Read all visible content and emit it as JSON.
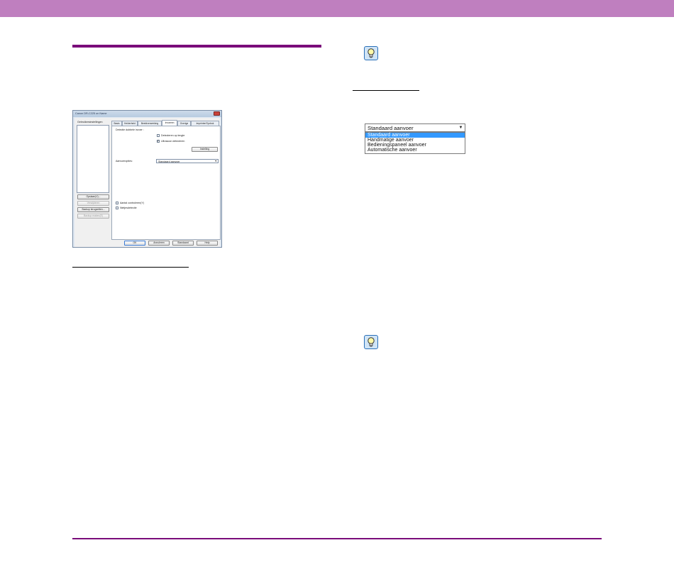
{
  "colors": {
    "header_band": "#bf7fbf",
    "accent_rule": "#7a0c7a",
    "hint_icon": "#2a6fb8",
    "selection": "#3399ff"
  },
  "icons": {
    "hint": "lightbulb-icon"
  },
  "dialog": {
    "title": "Canon DR-C225 on Name",
    "sidebar_label": "Gebruikersinstellingen",
    "side_buttons": [
      {
        "label": "Opslaan(V)...",
        "enabled": true
      },
      {
        "label": "Verwijderen",
        "enabled": false
      },
      {
        "label": "Backup terugzetten...",
        "enabled": true
      },
      {
        "label": "Backup maken(E)",
        "enabled": false
      }
    ],
    "tabs": [
      "Basis",
      "Helderheid",
      "Beeldverwerking",
      "Invoeren",
      "Overige",
      "Imprinter/Opdruk"
    ],
    "active_tab": "Invoeren",
    "double_feed_group": "Detectie dubbele invoer :",
    "detect_by_length": "Detecteren op lengte",
    "ultrasonic_detect": "Ultrasoon detecteren",
    "settings_button": "Instelling",
    "feed_options_label": "Aanvoeropties:",
    "feed_options_value": "Standaard aanvoer",
    "batch_count": "Aantal controleren(Y)",
    "staple_detect": "Nietjesdetectie",
    "footer_buttons": [
      "OK",
      "Annuleren",
      "Standaard",
      "Help"
    ]
  },
  "dropdown": {
    "current_value": "Standaard aanvoer",
    "options": [
      "Standaard aanvoer",
      "Handmatige aanvoer",
      "Bedieningspaneel aanvoer",
      "Automatische aanvoer"
    ],
    "selected_index": 0
  }
}
